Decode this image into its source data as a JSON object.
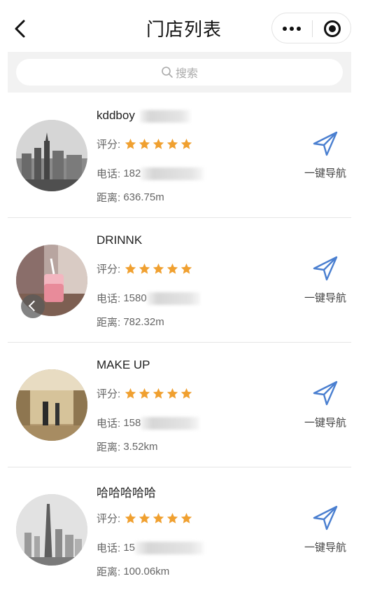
{
  "header": {
    "title": "门店列表"
  },
  "search": {
    "placeholder": "搜索"
  },
  "rating_label": "评分:",
  "stores": [
    {
      "name": "kddboy",
      "rating": 5,
      "phone_label": "电话:",
      "phone_visible": "182",
      "distance_label": "距离:",
      "distance": "636.75m",
      "nav_label": "一键导航"
    },
    {
      "name": "DRINNK",
      "rating": 5,
      "phone_label": "电话:",
      "phone_visible": "1580",
      "distance_label": "距离:",
      "distance": "782.32m",
      "nav_label": "一键导航"
    },
    {
      "name": "MAKE UP",
      "rating": 5,
      "phone_label": "电话:",
      "phone_visible": "158",
      "distance_label": "距离:",
      "distance": "3.52km",
      "nav_label": "一键导航"
    },
    {
      "name": "哈哈哈哈哈",
      "rating": 5,
      "phone_label": "电话:",
      "phone_visible": "15",
      "distance_label": "距离:",
      "distance": "100.06km",
      "nav_label": "一键导航"
    }
  ],
  "colors": {
    "star": "#f0a030",
    "nav_icon": "#4a7fd0",
    "search_bg": "#f2f2f2"
  }
}
